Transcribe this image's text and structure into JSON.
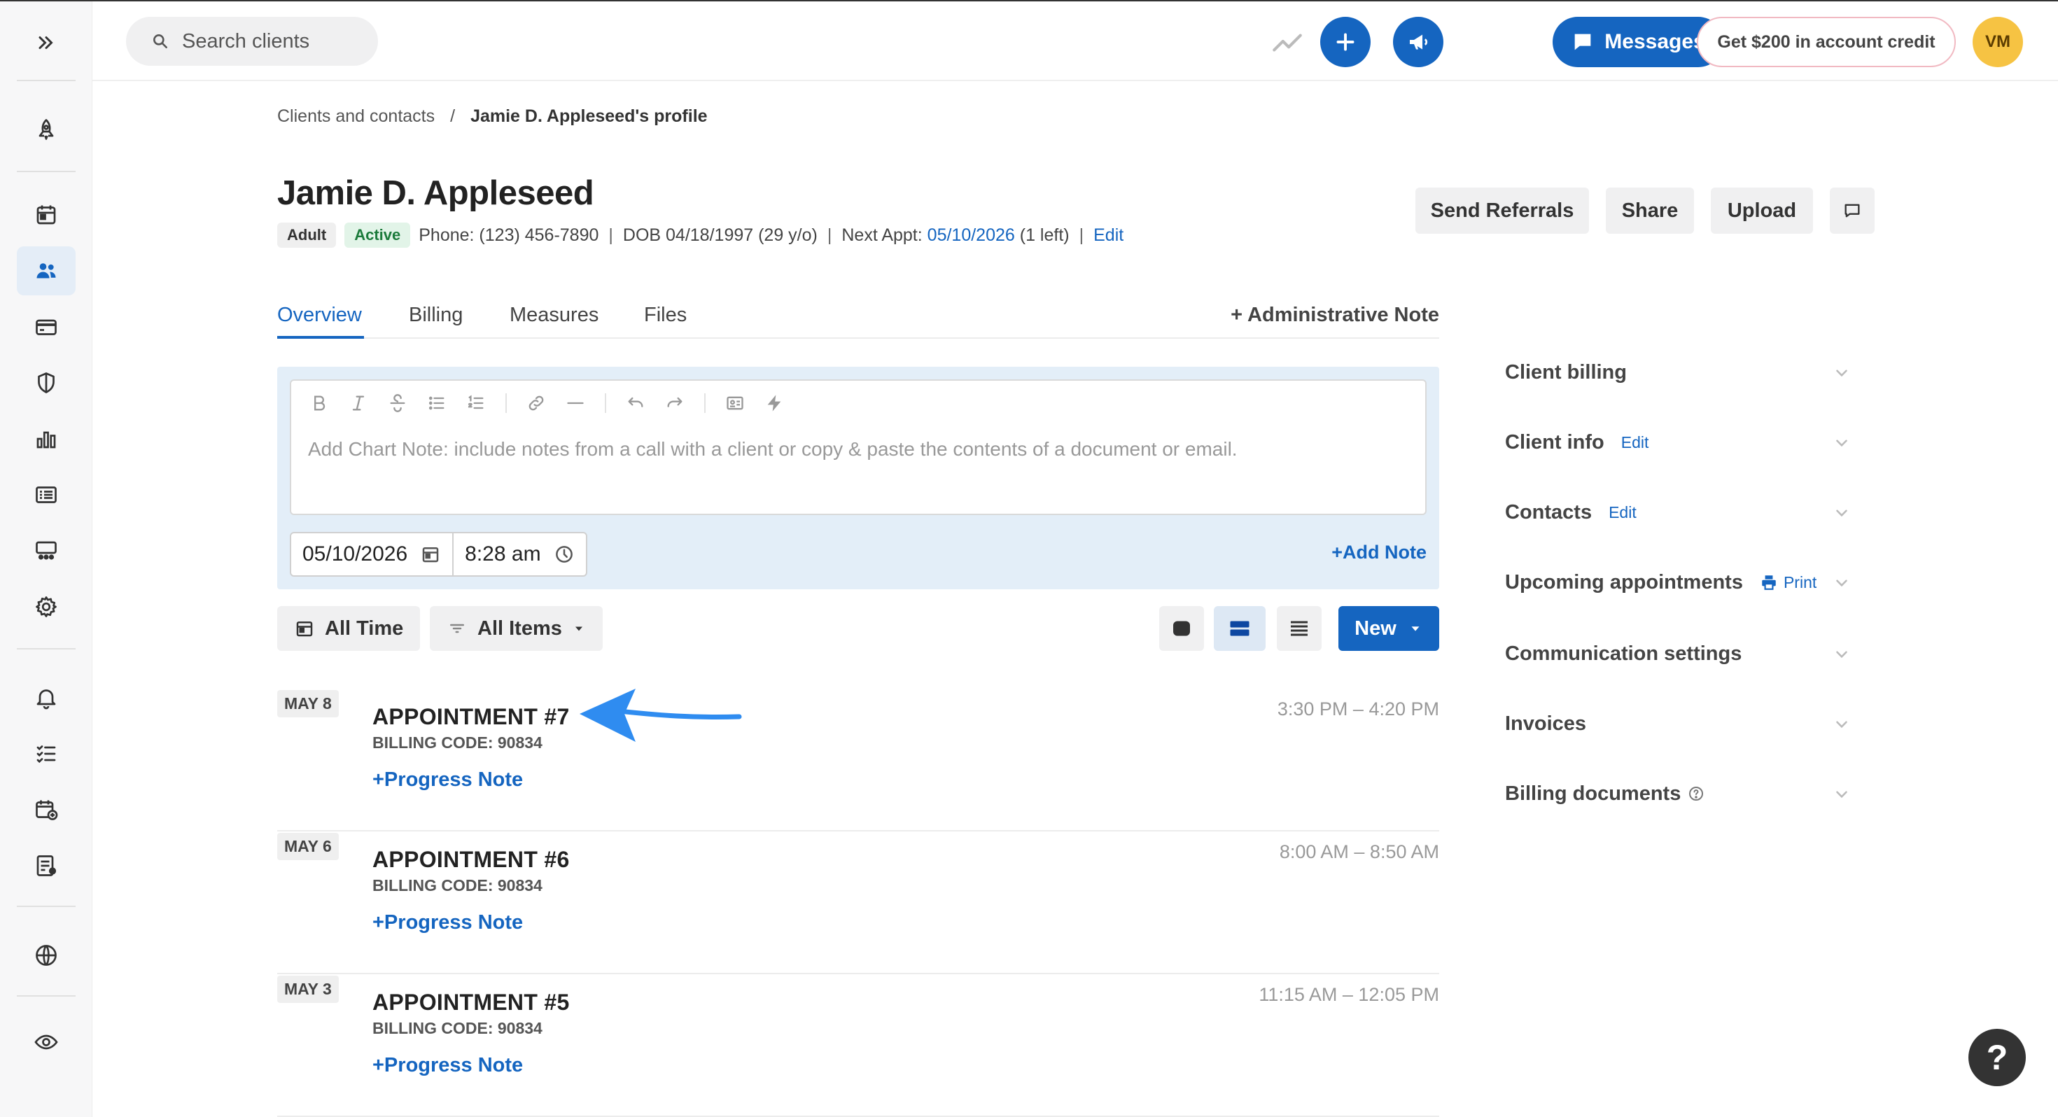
{
  "search": {
    "placeholder": "Search clients"
  },
  "topbar": {
    "messages_label": "Messages",
    "credit_label": "Get $200 in account credit",
    "avatar_initials": "VM"
  },
  "breadcrumb": {
    "parent": "Clients and contacts",
    "separator": "/",
    "current": "Jamie D. Appleseed's profile"
  },
  "client": {
    "name": "Jamie D. Appleseed",
    "tags": [
      "Adult",
      "Active"
    ],
    "phone": "Phone: (123) 456-7890",
    "dob": "DOB 04/18/1997 (29 y/o)",
    "next_appt_label": "Next Appt:",
    "next_appt_date": "05/10/2026",
    "next_appt_suffix": "(1 left)",
    "edit_label": "Edit"
  },
  "header_actions": {
    "send_referrals": "Send Referrals",
    "share": "Share",
    "upload": "Upload"
  },
  "tabs": [
    "Overview",
    "Billing",
    "Measures",
    "Files"
  ],
  "admin_note_label": "+ Administrative Note",
  "note_editor": {
    "placeholder": "Add Chart Note: include notes from a call with a client or copy & paste the contents of a document or email.",
    "date": "05/10/2026",
    "time": "8:28 am",
    "add_note_label": "+Add Note"
  },
  "filters": {
    "all_time": "All Time",
    "all_items": "All Items",
    "new_label": "New"
  },
  "appointments": [
    {
      "date": "MAY 8",
      "title": "APPOINTMENT #7",
      "code": "BILLING CODE: 90834",
      "time": "3:30 PM – 4:20 PM",
      "action": "+Progress Note"
    },
    {
      "date": "MAY 6",
      "title": "APPOINTMENT #6",
      "code": "BILLING CODE: 90834",
      "time": "8:00 AM – 8:50 AM",
      "action": "+Progress Note"
    },
    {
      "date": "MAY 3",
      "title": "APPOINTMENT #5",
      "code": "BILLING CODE: 90834",
      "time": "11:15 AM – 12:05 PM",
      "action": "+Progress Note"
    }
  ],
  "right_panel": [
    {
      "title": "Client billing",
      "link": ""
    },
    {
      "title": "Client info",
      "link": "Edit"
    },
    {
      "title": "Contacts",
      "link": "Edit"
    },
    {
      "title": "Upcoming appointments",
      "link": "Print"
    },
    {
      "title": "Communication settings",
      "link": ""
    },
    {
      "title": "Invoices",
      "link": ""
    },
    {
      "title": "Billing documents",
      "link": ""
    }
  ],
  "help_label": "?",
  "colors": {
    "accent": "#1565c0",
    "active_tag_bg": "#e2f4e8",
    "active_tag_text": "#1b7a3a",
    "avatar": "#f6c343",
    "annotation_arrow": "#2f8cf0"
  }
}
